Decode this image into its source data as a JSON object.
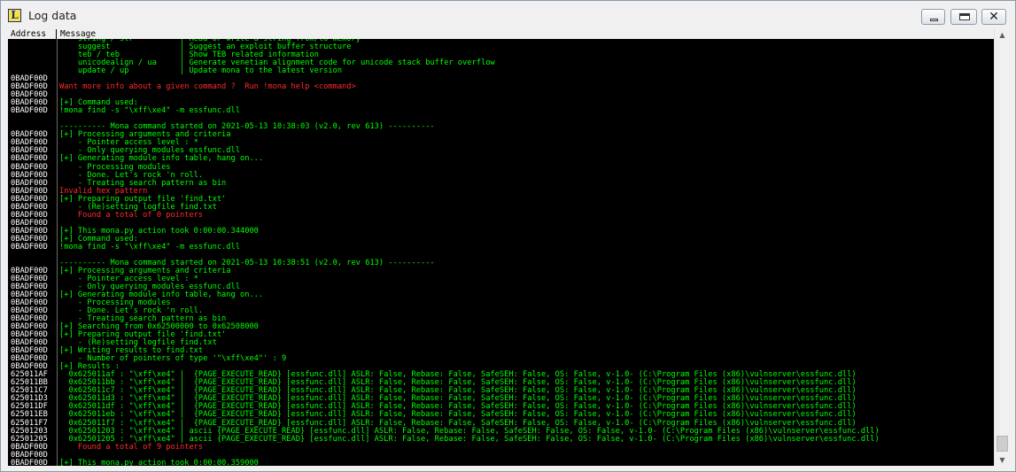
{
  "window": {
    "title": "Log data",
    "app_icon_letter": "L",
    "controls": {
      "minimize": "minimize",
      "maximize": "maximize",
      "close": "✕"
    }
  },
  "columns": {
    "address": "Address",
    "message": "Message"
  },
  "colors": {
    "background": "#000000",
    "text": "#00ff00",
    "error": "#ff2a2a",
    "address": "#ffffff"
  },
  "log_lines": [
    {
      "addr": "",
      "text": "    string / str          | Read or write a string from/to memory",
      "color": "green"
    },
    {
      "addr": "",
      "text": "    suggest               | Suggest an exploit buffer structure",
      "color": "green"
    },
    {
      "addr": "",
      "text": "    teb / teb             | Show TEB related information",
      "color": "green"
    },
    {
      "addr": "",
      "text": "    unicodealign / ua     | Generate venetian alignment code for unicode stack buffer overflow",
      "color": "green"
    },
    {
      "addr": "",
      "text": "    update / up           | Update mona to the latest version",
      "color": "green"
    },
    {
      "addr": "0BADF00D",
      "text": "",
      "color": "green"
    },
    {
      "addr": "0BADF00D",
      "text": "Want more info about a given command ?  Run !mona help <command>",
      "color": "red"
    },
    {
      "addr": "0BADF00D",
      "text": "",
      "color": "green"
    },
    {
      "addr": "0BADF00D",
      "text": "[+] Command used:",
      "color": "green"
    },
    {
      "addr": "0BADF00D",
      "text": "!mona find -s \"\\xff\\xe4\" -m essfunc.dll",
      "color": "green"
    },
    {
      "addr": "",
      "text": "",
      "color": "green"
    },
    {
      "addr": "",
      "text": "---------- Mona command started on 2021-05-13 10:38:03 (v2.0, rev 613) ----------",
      "color": "green"
    },
    {
      "addr": "0BADF00D",
      "text": "[+] Processing arguments and criteria",
      "color": "green"
    },
    {
      "addr": "0BADF00D",
      "text": "    - Pointer access level : *",
      "color": "green"
    },
    {
      "addr": "0BADF00D",
      "text": "    - Only querying modules essfunc.dll",
      "color": "green"
    },
    {
      "addr": "0BADF00D",
      "text": "[+] Generating module info table, hang on...",
      "color": "green"
    },
    {
      "addr": "0BADF00D",
      "text": "    - Processing modules",
      "color": "green"
    },
    {
      "addr": "0BADF00D",
      "text": "    - Done. Let's rock 'n roll.",
      "color": "green"
    },
    {
      "addr": "0BADF00D",
      "text": "    - Treating search pattern as bin",
      "color": "green"
    },
    {
      "addr": "0BADF00D",
      "text": "Invalid hex pattern",
      "color": "red"
    },
    {
      "addr": "0BADF00D",
      "text": "[+] Preparing output file 'find.txt'",
      "color": "green"
    },
    {
      "addr": "0BADF00D",
      "text": "    - (Re)setting logfile find.txt",
      "color": "green"
    },
    {
      "addr": "0BADF00D",
      "text": "    Found a total of 0 pointers",
      "color": "red"
    },
    {
      "addr": "0BADF00D",
      "text": "",
      "color": "green"
    },
    {
      "addr": "0BADF00D",
      "text": "[+] This mona.py action took 0:00:00.344000",
      "color": "green"
    },
    {
      "addr": "0BADF00D",
      "text": "[+] Command used:",
      "color": "green"
    },
    {
      "addr": "0BADF00D",
      "text": "!mona find -s \"\\xff\\xe4\" -m essfunc.dll",
      "color": "green"
    },
    {
      "addr": "",
      "text": "",
      "color": "green"
    },
    {
      "addr": "",
      "text": "---------- Mona command started on 2021-05-13 10:38:51 (v2.0, rev 613) ----------",
      "color": "green"
    },
    {
      "addr": "0BADF00D",
      "text": "[+] Processing arguments and criteria",
      "color": "green"
    },
    {
      "addr": "0BADF00D",
      "text": "    - Pointer access level : *",
      "color": "green"
    },
    {
      "addr": "0BADF00D",
      "text": "    - Only querying modules essfunc.dll",
      "color": "green"
    },
    {
      "addr": "0BADF00D",
      "text": "[+] Generating module info table, hang on...",
      "color": "green"
    },
    {
      "addr": "0BADF00D",
      "text": "    - Processing modules",
      "color": "green"
    },
    {
      "addr": "0BADF00D",
      "text": "    - Done. Let's rock 'n roll.",
      "color": "green"
    },
    {
      "addr": "0BADF00D",
      "text": "    - Treating search pattern as bin",
      "color": "green"
    },
    {
      "addr": "0BADF00D",
      "text": "[+] Searching from 0x62500000 to 0x62508000",
      "color": "green"
    },
    {
      "addr": "0BADF00D",
      "text": "[+] Preparing output file 'find.txt'",
      "color": "green"
    },
    {
      "addr": "0BADF00D",
      "text": "    - (Re)setting logfile find.txt",
      "color": "green"
    },
    {
      "addr": "0BADF00D",
      "text": "[+] Writing results to find.txt",
      "color": "green"
    },
    {
      "addr": "0BADF00D",
      "text": "    - Number of pointers of type '\"\\xff\\xe4\"' : 9",
      "color": "green"
    },
    {
      "addr": "0BADF00D",
      "text": "[+] Results :",
      "color": "green"
    },
    {
      "addr": "625011AF",
      "text": "  0x625011af : \"\\xff\\xe4\" |  {PAGE_EXECUTE_READ} [essfunc.dll] ASLR: False, Rebase: False, SafeSEH: False, OS: False, v-1.0- (C:\\Program Files (x86)\\vulnserver\\essfunc.dll)",
      "color": "green"
    },
    {
      "addr": "625011BB",
      "text": "  0x625011bb : \"\\xff\\xe4\" |  {PAGE_EXECUTE_READ} [essfunc.dll] ASLR: False, Rebase: False, SafeSEH: False, OS: False, v-1.0- (C:\\Program Files (x86)\\vulnserver\\essfunc.dll)",
      "color": "green"
    },
    {
      "addr": "625011C7",
      "text": "  0x625011c7 : \"\\xff\\xe4\" |  {PAGE_EXECUTE_READ} [essfunc.dll] ASLR: False, Rebase: False, SafeSEH: False, OS: False, v-1.0- (C:\\Program Files (x86)\\vulnserver\\essfunc.dll)",
      "color": "green"
    },
    {
      "addr": "625011D3",
      "text": "  0x625011d3 : \"\\xff\\xe4\" |  {PAGE_EXECUTE_READ} [essfunc.dll] ASLR: False, Rebase: False, SafeSEH: False, OS: False, v-1.0- (C:\\Program Files (x86)\\vulnserver\\essfunc.dll)",
      "color": "green"
    },
    {
      "addr": "625011DF",
      "text": "  0x625011df : \"\\xff\\xe4\" |  {PAGE_EXECUTE_READ} [essfunc.dll] ASLR: False, Rebase: False, SafeSEH: False, OS: False, v-1.0- (C:\\Program Files (x86)\\vulnserver\\essfunc.dll)",
      "color": "green"
    },
    {
      "addr": "625011EB",
      "text": "  0x625011eb : \"\\xff\\xe4\" |  {PAGE_EXECUTE_READ} [essfunc.dll] ASLR: False, Rebase: False, SafeSEH: False, OS: False, v-1.0- (C:\\Program Files (x86)\\vulnserver\\essfunc.dll)",
      "color": "green"
    },
    {
      "addr": "625011F7",
      "text": "  0x625011f7 : \"\\xff\\xe4\" |  {PAGE_EXECUTE_READ} [essfunc.dll] ASLR: False, Rebase: False, SafeSEH: False, OS: False, v-1.0- (C:\\Program Files (x86)\\vulnserver\\essfunc.dll)",
      "color": "green"
    },
    {
      "addr": "62501203",
      "text": "  0x62501203 : \"\\xff\\xe4\" | ascii {PAGE_EXECUTE_READ} [essfunc.dll] ASLR: False, Rebase: False, SafeSEH: False, OS: False, v-1.0- (C:\\Program Files (x86)\\vulnserver\\essfunc.dll)",
      "color": "green"
    },
    {
      "addr": "62501205",
      "text": "  0x62501205 : \"\\xff\\xe4\" | ascii {PAGE_EXECUTE_READ} [essfunc.dll] ASLR: False, Rebase: False, SafeSEH: False, OS: False, v-1.0- (C:\\Program Files (x86)\\vulnserver\\essfunc.dll)",
      "color": "green"
    },
    {
      "addr": "0BADF00D",
      "text": "    Found a total of 9 pointers",
      "color": "red"
    },
    {
      "addr": "0BADF00D",
      "text": "",
      "color": "green"
    },
    {
      "addr": "0BADF00D",
      "text": "[+] This mona.py action took 0:00:00.359000",
      "color": "green"
    }
  ]
}
